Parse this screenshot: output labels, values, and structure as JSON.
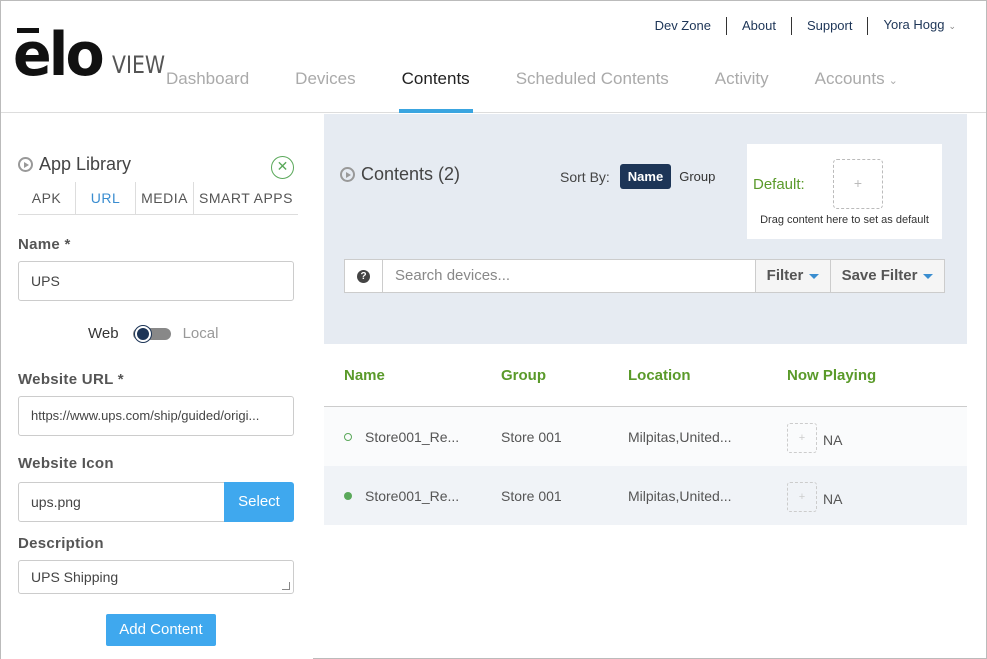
{
  "brand": {
    "logo_main": "elo",
    "logo_sub": "VIEW"
  },
  "top_links": [
    "Dev Zone",
    "About",
    "Support"
  ],
  "user": {
    "name": "Yora Hogg"
  },
  "nav": {
    "items": [
      "Dashboard",
      "Devices",
      "Contents",
      "Scheduled Contents",
      "Activity",
      "Accounts"
    ],
    "active": "Contents"
  },
  "library": {
    "title": "App Library",
    "tabs": [
      "APK",
      "URL",
      "MEDIA",
      "SMART APPS"
    ],
    "active_tab": "URL",
    "name_label": "Name *",
    "name_value": "UPS",
    "toggle_left": "Web",
    "toggle_right": "Local",
    "url_label": "Website URL *",
    "url_value": "https://www.ups.com/ship/guided/origi...",
    "icon_label": "Website Icon",
    "icon_value": "ups.png",
    "select_label": "Select",
    "desc_label": "Description",
    "desc_value": "UPS Shipping",
    "add_label": "Add Content"
  },
  "contents": {
    "title": "Contents (2)",
    "sort_label": "Sort By:",
    "sort_name": "Name",
    "sort_group": "Group",
    "default_label": "Default:",
    "default_plus": "+",
    "default_hint": "Drag content here to set as default",
    "search_placeholder": "Search devices...",
    "help_glyph": "?",
    "filter_label": "Filter",
    "save_filter_label": "Save Filter"
  },
  "table": {
    "headers": [
      "Name",
      "Group",
      "Location",
      "Now Playing"
    ],
    "rows": [
      {
        "name": "Store001_Re...",
        "group": "Store 001",
        "location": "Milpitas,United...",
        "thumb": "+",
        "now_playing": "NA",
        "status": "hollow"
      },
      {
        "name": "Store001_Re...",
        "group": "Store 001",
        "location": "Milpitas,United...",
        "thumb": "+",
        "now_playing": "NA",
        "status": "filled"
      }
    ]
  },
  "colors": {
    "accent_blue": "#3fa8ee",
    "nav_underline": "#3aa5e0",
    "navy": "#1d3557",
    "green": "#5a9a2a",
    "panel_bg": "#e6ebf2"
  }
}
